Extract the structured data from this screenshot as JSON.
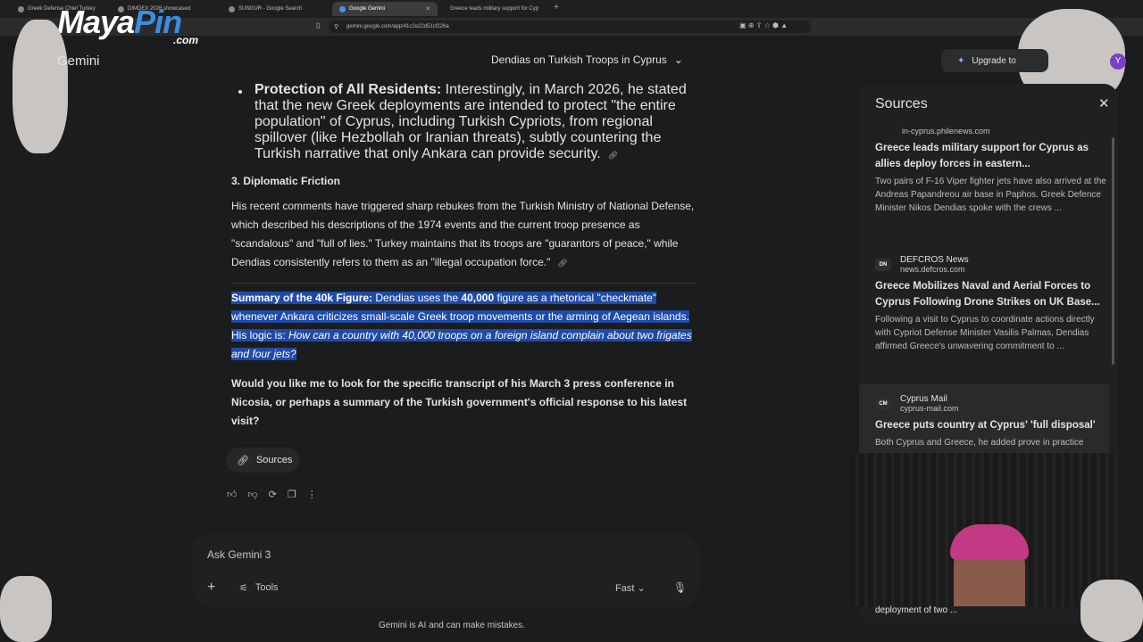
{
  "browser": {
    "tabs": [
      {
        "label": "Greek Defense Chief Turkey",
        "active": false
      },
      {
        "label": "DIMDEX 2026 showcased",
        "active": false
      },
      {
        "label": "SUNGUR - Google Search",
        "active": false
      },
      {
        "label": "Google Gemini",
        "active": true
      },
      {
        "label": "Greece leads military support for Cyp",
        "active": false
      }
    ],
    "url": "gemini.google.com/app/41c2e22d51cf226a"
  },
  "overlay": {
    "logo_main": "Maya",
    "logo_pin": "Pin",
    "logo_com": ".com"
  },
  "header": {
    "app_title": "Gemini",
    "conversation_title": "Dendias on Turkish Troops in Cyprus",
    "upgrade_label": "Upgrade to",
    "avatar_letter": "Y"
  },
  "chat": {
    "bullet_bold": "Protection of All Residents:",
    "bullet_text": " Interestingly, in March 2026, he stated that the new Greek deployments are intended to protect \"the entire population\" of Cyprus, including Turkish Cypriots, from regional spillover (like Hezbollah or Iranian threats), subtly countering the Turkish narrative that only Ankara can provide security.",
    "section_heading": "3. Diplomatic Friction",
    "section_text": "His recent comments have triggered sharp rebukes from the Turkish Ministry of National Defense, which described his descriptions of the 1974 events and the current troop presence as \"scandalous\" and \"full of lies.\" Turkey maintains that its troops are \"guarantors of peace,\" while Dendias consistently refers to them as an \"illegal occupation force.\"",
    "summary_bold": "Summary of the 40k Figure:",
    "summary_a": " Dendias uses the ",
    "summary_num": "40,000",
    "summary_b": " figure as a rhetorical \"checkmate\" whenever Ankara criticizes small-scale Greek troop movements or the arming of Aegean islands. His logic is: ",
    "summary_italic": "How can a country with 40,000 troops on a foreign island complain about two frigates and four jets?",
    "question": "Would you like me to look for the specific transcript of his March 3 press conference in Nicosia, or perhaps a summary of the Turkish government's official response to his latest visit?",
    "sources_button": "Sources"
  },
  "input": {
    "placeholder": "Ask Gemini 3",
    "tools_label": "Tools",
    "mode_label": "Fast"
  },
  "disclaimer": "Gemini is AI and can make mistakes.",
  "sources_panel": {
    "title": "Sources",
    "items": [
      {
        "site": "in-cyprus.philenews.com",
        "publisher": "",
        "title": "Greece leads military support for Cyprus as allies deploy forces in eastern...",
        "snippet": "Two pairs of F-16 Viper fighter jets have also arrived at the Andreas Papandreou air base in Paphos. Greek Defence Minister Nikos Dendias spoke with the crews ..."
      },
      {
        "badge": "DN",
        "publisher": "DEFCROS News",
        "site": "news.defcros.com",
        "title": "Greece Mobilizes Naval and Aerial Forces to Cyprus Following Drone Strikes on UK Base...",
        "snippet": "Following a visit to Cyprus to coordinate actions directly with Cypriot Defense Minister Vasilis Palmas, Dendias affirmed Greece's unwavering commitment to ..."
      },
      {
        "badge": "CM",
        "publisher": "Cyprus Mail",
        "site": "cyprus-mail.com",
        "title": "Greece puts country at Cyprus' 'full disposal'",
        "snippet": "Both Cyprus and Greece, he added prove in practice"
      }
    ],
    "last_line": "deployment of two ..."
  }
}
